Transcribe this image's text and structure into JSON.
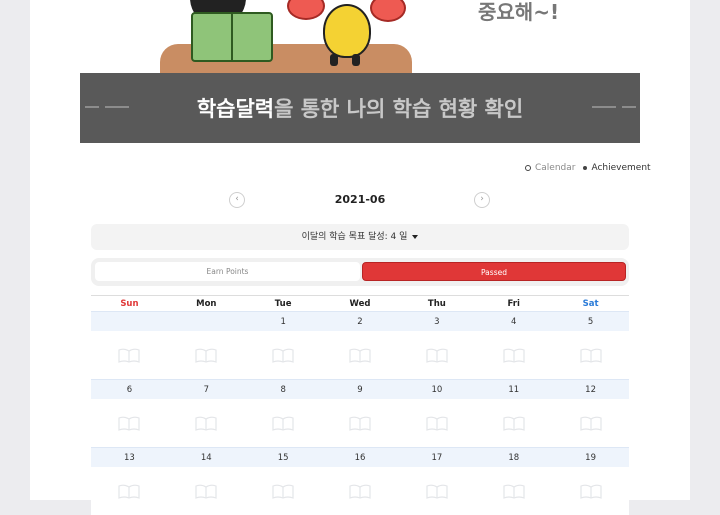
{
  "hero": {
    "handwriting": "중요해~!"
  },
  "banner": {
    "title_highlight": "학습달력",
    "title_rest": "을 통한 나의 학습 현황 확인"
  },
  "legend": {
    "calendar_label": "Calendar",
    "achievement_label": "Achievement"
  },
  "calendar": {
    "prev_label": "‹",
    "next_label": "›",
    "month": "2021-06",
    "goal_text": "이달의 학습 목표 달성: 4 일",
    "tabs": {
      "earn_points": "Earn Points",
      "passed": "Passed"
    },
    "weekdays": [
      "Sun",
      "Mon",
      "Tue",
      "Wed",
      "Thu",
      "Fri",
      "Sat"
    ],
    "weeks": [
      [
        "",
        "",
        "1",
        "2",
        "3",
        "4",
        "5"
      ],
      [
        "6",
        "7",
        "8",
        "9",
        "10",
        "11",
        "12"
      ],
      [
        "13",
        "14",
        "15",
        "16",
        "17",
        "18",
        "19"
      ]
    ],
    "day_icon": "open-book-icon"
  },
  "colors": {
    "accent_red": "#e03737",
    "saturday_blue": "#2a7bd8",
    "banner_bg": "#595959",
    "date_row_bg": "#eef4fc"
  }
}
